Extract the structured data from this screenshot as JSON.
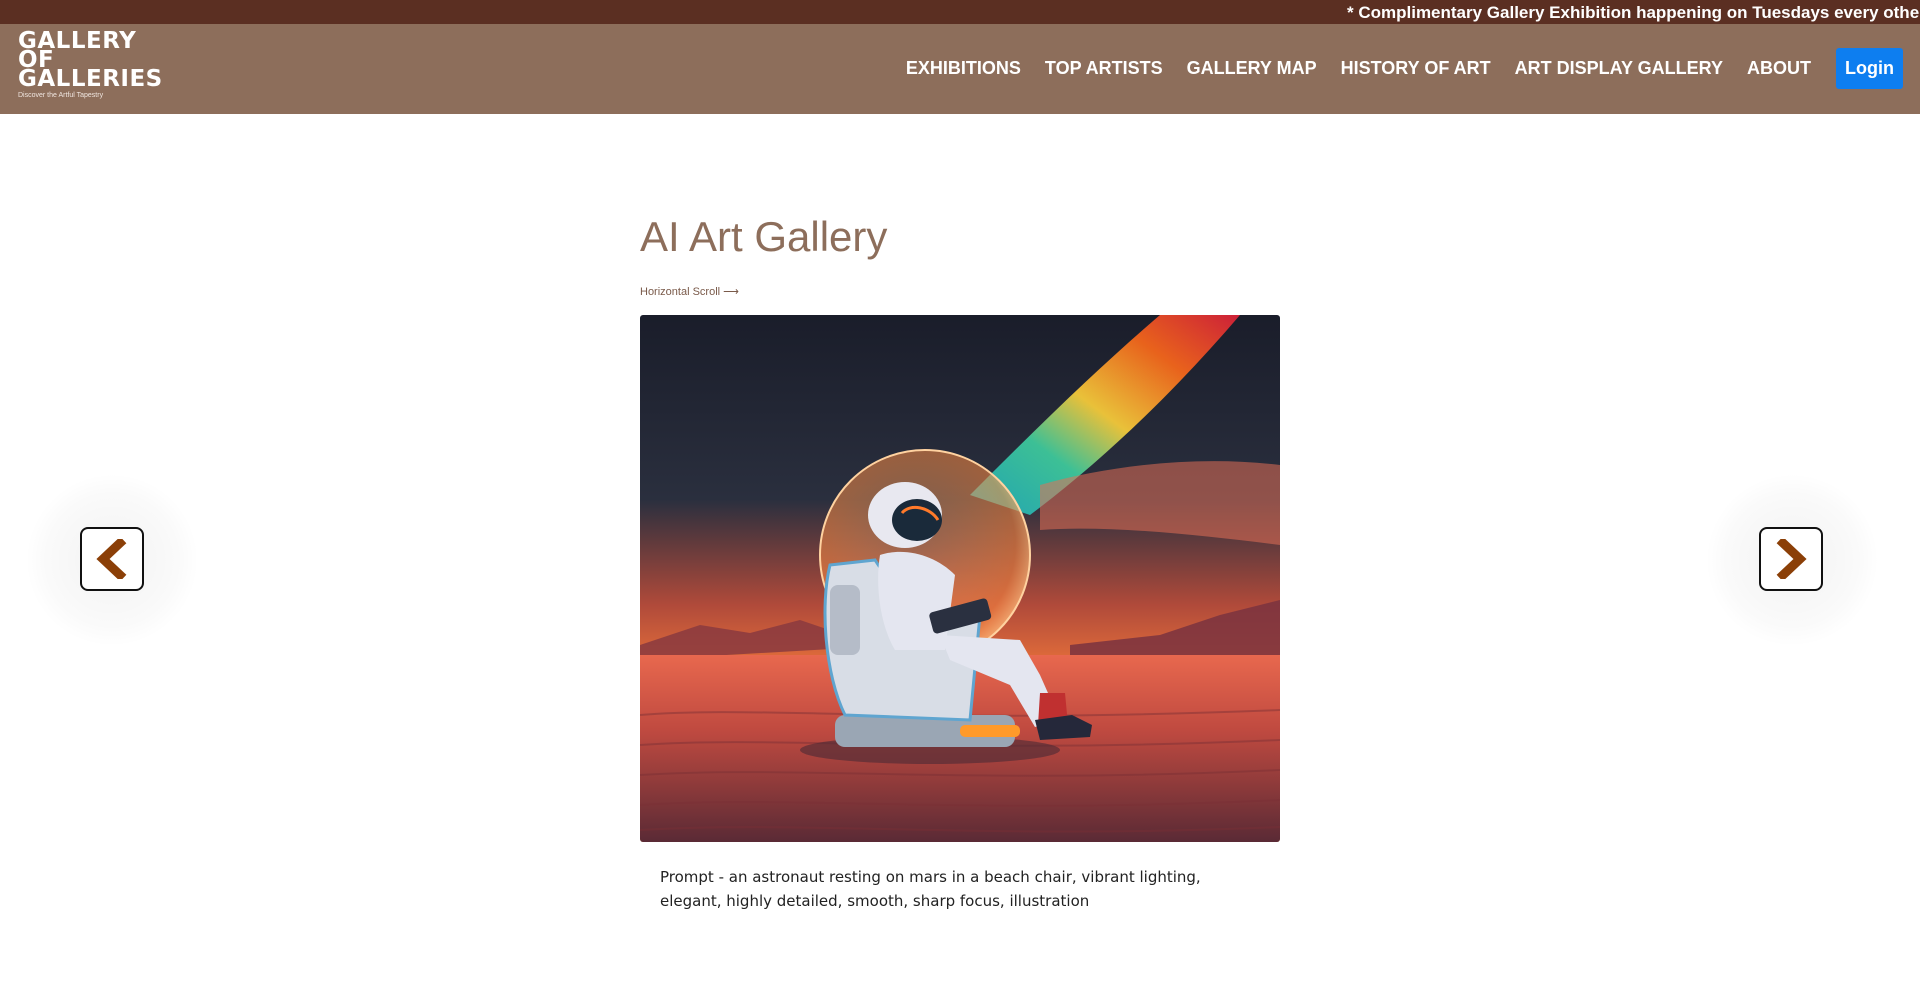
{
  "announcement": "* Complimentary Gallery Exhibition happening on Tuesdays every other wee",
  "logo": {
    "line1": "GALLERY",
    "line2": "OF",
    "line3": "GALLERIES",
    "tagline": "Discover the Artful Tapestry"
  },
  "nav": {
    "items": [
      "EXHIBITIONS",
      "TOP ARTISTS",
      "GALLERY MAP",
      "HISTORY OF ART",
      "ART DISPLAY GALLERY",
      "ABOUT"
    ],
    "login_label": "Login"
  },
  "main": {
    "title": "AI Art Gallery",
    "scroll_hint": "Horizontal Scroll ⟶",
    "caption": "Prompt - an astronaut resting on mars in a beach chair, vibrant lighting, elegant, highly detailed, smooth, sharp focus, illustration"
  },
  "icons": {
    "prev": "chevron-left-icon",
    "next": "chevron-right-icon"
  },
  "colors": {
    "topbar": "#5b2f22",
    "navbar": "#8d6e5b",
    "accent": "#8d6e5b",
    "login": "#0d7ef0",
    "arrow": "#8b3f07"
  }
}
